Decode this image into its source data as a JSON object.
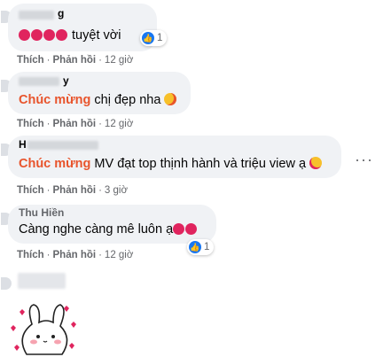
{
  "comments": [
    {
      "name": "g",
      "text": "tuyệt vời",
      "hearts": 4,
      "reaction_count": "1",
      "actions": {
        "like": "Thích",
        "reply": "Phản hồi",
        "time": "12 giờ"
      }
    },
    {
      "name": "y",
      "keyword": "Chúc mừng",
      "text": "chị đẹp nha",
      "emoji": "kiss-emoji",
      "actions": {
        "like": "Thích",
        "reply": "Phản hồi",
        "time": "12 giờ"
      }
    },
    {
      "name": "H",
      "keyword": "Chúc mừng",
      "text": "MV đạt top thịnh hành và triệu view ạ",
      "emoji": "smiling-hearts-emoji",
      "more_label": "···",
      "actions": {
        "like": "Thích",
        "reply": "Phản hồi",
        "time": "3 giờ"
      }
    },
    {
      "name": "Thu Hiền",
      "text": "Càng nghe càng mê luôn ạ",
      "hearts": 2,
      "reaction_count": "1",
      "actions": {
        "like": "Thích",
        "reply": "Phản hồi",
        "time": "12 giờ"
      }
    }
  ],
  "colors": {
    "keyword": "#e8542c",
    "bubble": "#f0f2f5",
    "meta": "#65676b",
    "like_blue": "#1877f2",
    "heart_red": "#e0245e"
  },
  "icons": {
    "reaction": "like-thumb-icon",
    "more": "ellipsis-icon",
    "sticker": "bunny-sticker-icon"
  }
}
